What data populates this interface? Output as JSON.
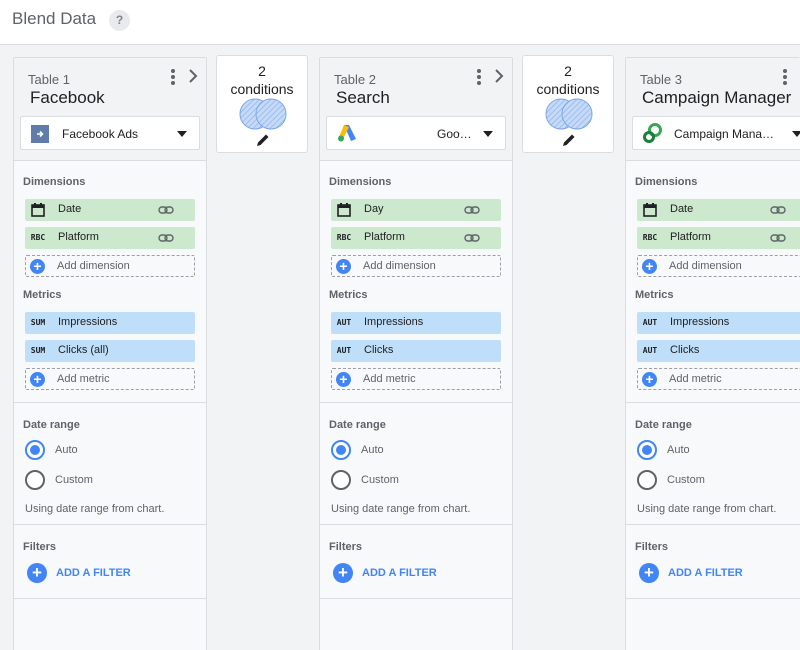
{
  "header": {
    "title": "Blend Data",
    "help": "?"
  },
  "tables": [
    {
      "label": "Table 1",
      "name": "Facebook",
      "source": {
        "name": "Facebook Ads",
        "icon": "facebook-ads-icon"
      },
      "dimensions_label": "Dimensions",
      "dimensions": [
        {
          "type": "calendar",
          "label": "Date"
        },
        {
          "type": "RBC",
          "label": "Platform"
        }
      ],
      "add_dimension": "Add dimension",
      "metrics_label": "Metrics",
      "metrics": [
        {
          "type": "SUM",
          "label": "Impressions"
        },
        {
          "type": "SUM",
          "label": "Clicks (all)"
        }
      ],
      "add_metric": "Add metric",
      "date_range_label": "Date range",
      "date_options": [
        "Auto",
        "Custom"
      ],
      "date_selected": "Auto",
      "date_note": "Using date range from chart.",
      "filters_label": "Filters",
      "add_filter": "ADD A FILTER"
    },
    {
      "label": "Table 2",
      "name": "Search",
      "source": {
        "name": "Goo…",
        "icon": "google-ads-icon"
      },
      "dimensions_label": "Dimensions",
      "dimensions": [
        {
          "type": "calendar",
          "label": "Day"
        },
        {
          "type": "RBC",
          "label": "Platform"
        }
      ],
      "add_dimension": "Add dimension",
      "metrics_label": "Metrics",
      "metrics": [
        {
          "type": "AUT",
          "label": "Impressions"
        },
        {
          "type": "AUT",
          "label": "Clicks"
        }
      ],
      "add_metric": "Add metric",
      "date_range_label": "Date range",
      "date_options": [
        "Auto",
        "Custom"
      ],
      "date_selected": "Auto",
      "date_note": "Using date range from chart.",
      "filters_label": "Filters",
      "add_filter": "ADD A FILTER"
    },
    {
      "label": "Table 3",
      "name": "Campaign Manager",
      "source": {
        "name": "Campaign Mana…",
        "icon": "campaign-manager-icon"
      },
      "dimensions_label": "Dimensions",
      "dimensions": [
        {
          "type": "calendar",
          "label": "Date"
        },
        {
          "type": "RBC",
          "label": "Platform"
        }
      ],
      "add_dimension": "Add dimension",
      "metrics_label": "Metrics",
      "metrics": [
        {
          "type": "AUT",
          "label": "Impressions"
        },
        {
          "type": "AUT",
          "label": "Clicks"
        }
      ],
      "add_metric": "Add metric",
      "date_range_label": "Date range",
      "date_options": [
        "Auto",
        "Custom"
      ],
      "date_selected": "Auto",
      "date_note": "Using date range from chart.",
      "filters_label": "Filters",
      "add_filter": "ADD A FILTER"
    }
  ],
  "joins": [
    {
      "count": "2",
      "label": "conditions"
    },
    {
      "count": "2",
      "label": "conditions"
    }
  ],
  "colors": {
    "dimension_chip": "#cde9cd",
    "metric_chip": "#bfdef9",
    "accent": "#4285f4"
  }
}
